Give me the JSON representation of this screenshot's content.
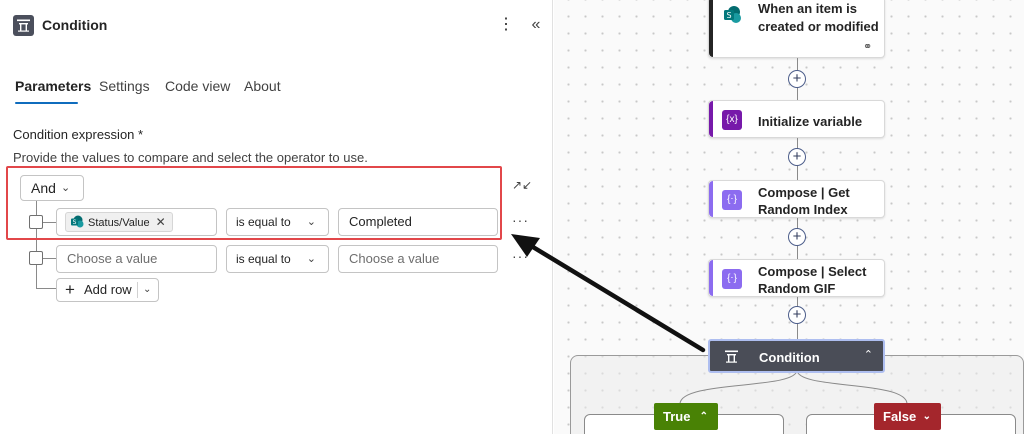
{
  "panel": {
    "title": "Condition",
    "more_label": "⋮",
    "collapse_label": "«"
  },
  "tabs": [
    {
      "label": "Parameters",
      "active": true
    },
    {
      "label": "Settings",
      "active": false
    },
    {
      "label": "Code view",
      "active": false
    },
    {
      "label": "About",
      "active": false
    }
  ],
  "condition": {
    "label": "Condition expression *",
    "help": "Provide the values to compare and select the operator to use.",
    "group_operator": "And",
    "rows": [
      {
        "left_token": "Status/Value",
        "operator": "is equal to",
        "right_value": "Completed",
        "more": "···"
      },
      {
        "left_placeholder": "Choose a value",
        "operator": "is equal to",
        "right_placeholder": "Choose a value",
        "more": "···"
      }
    ],
    "add_row_label": "Add row"
  },
  "flow": {
    "trigger": {
      "line1": "When an item is",
      "line2": "created or modified"
    },
    "steps": [
      {
        "line1": "Initialize variable",
        "accent": "#7719aa"
      },
      {
        "line1": "Compose | Get",
        "line2": "Random Index",
        "accent": "#8c6cf0"
      },
      {
        "line1": "Compose | Select",
        "line2": "Random GIF",
        "accent": "#8c6cf0"
      }
    ],
    "condition_card": "Condition",
    "true_label": "True",
    "false_label": "False",
    "true_color": "#498205",
    "false_color": "#a4262c"
  },
  "colors": {
    "accent_blue": "#0f6cbd",
    "highlight_red": "#e2474a"
  }
}
